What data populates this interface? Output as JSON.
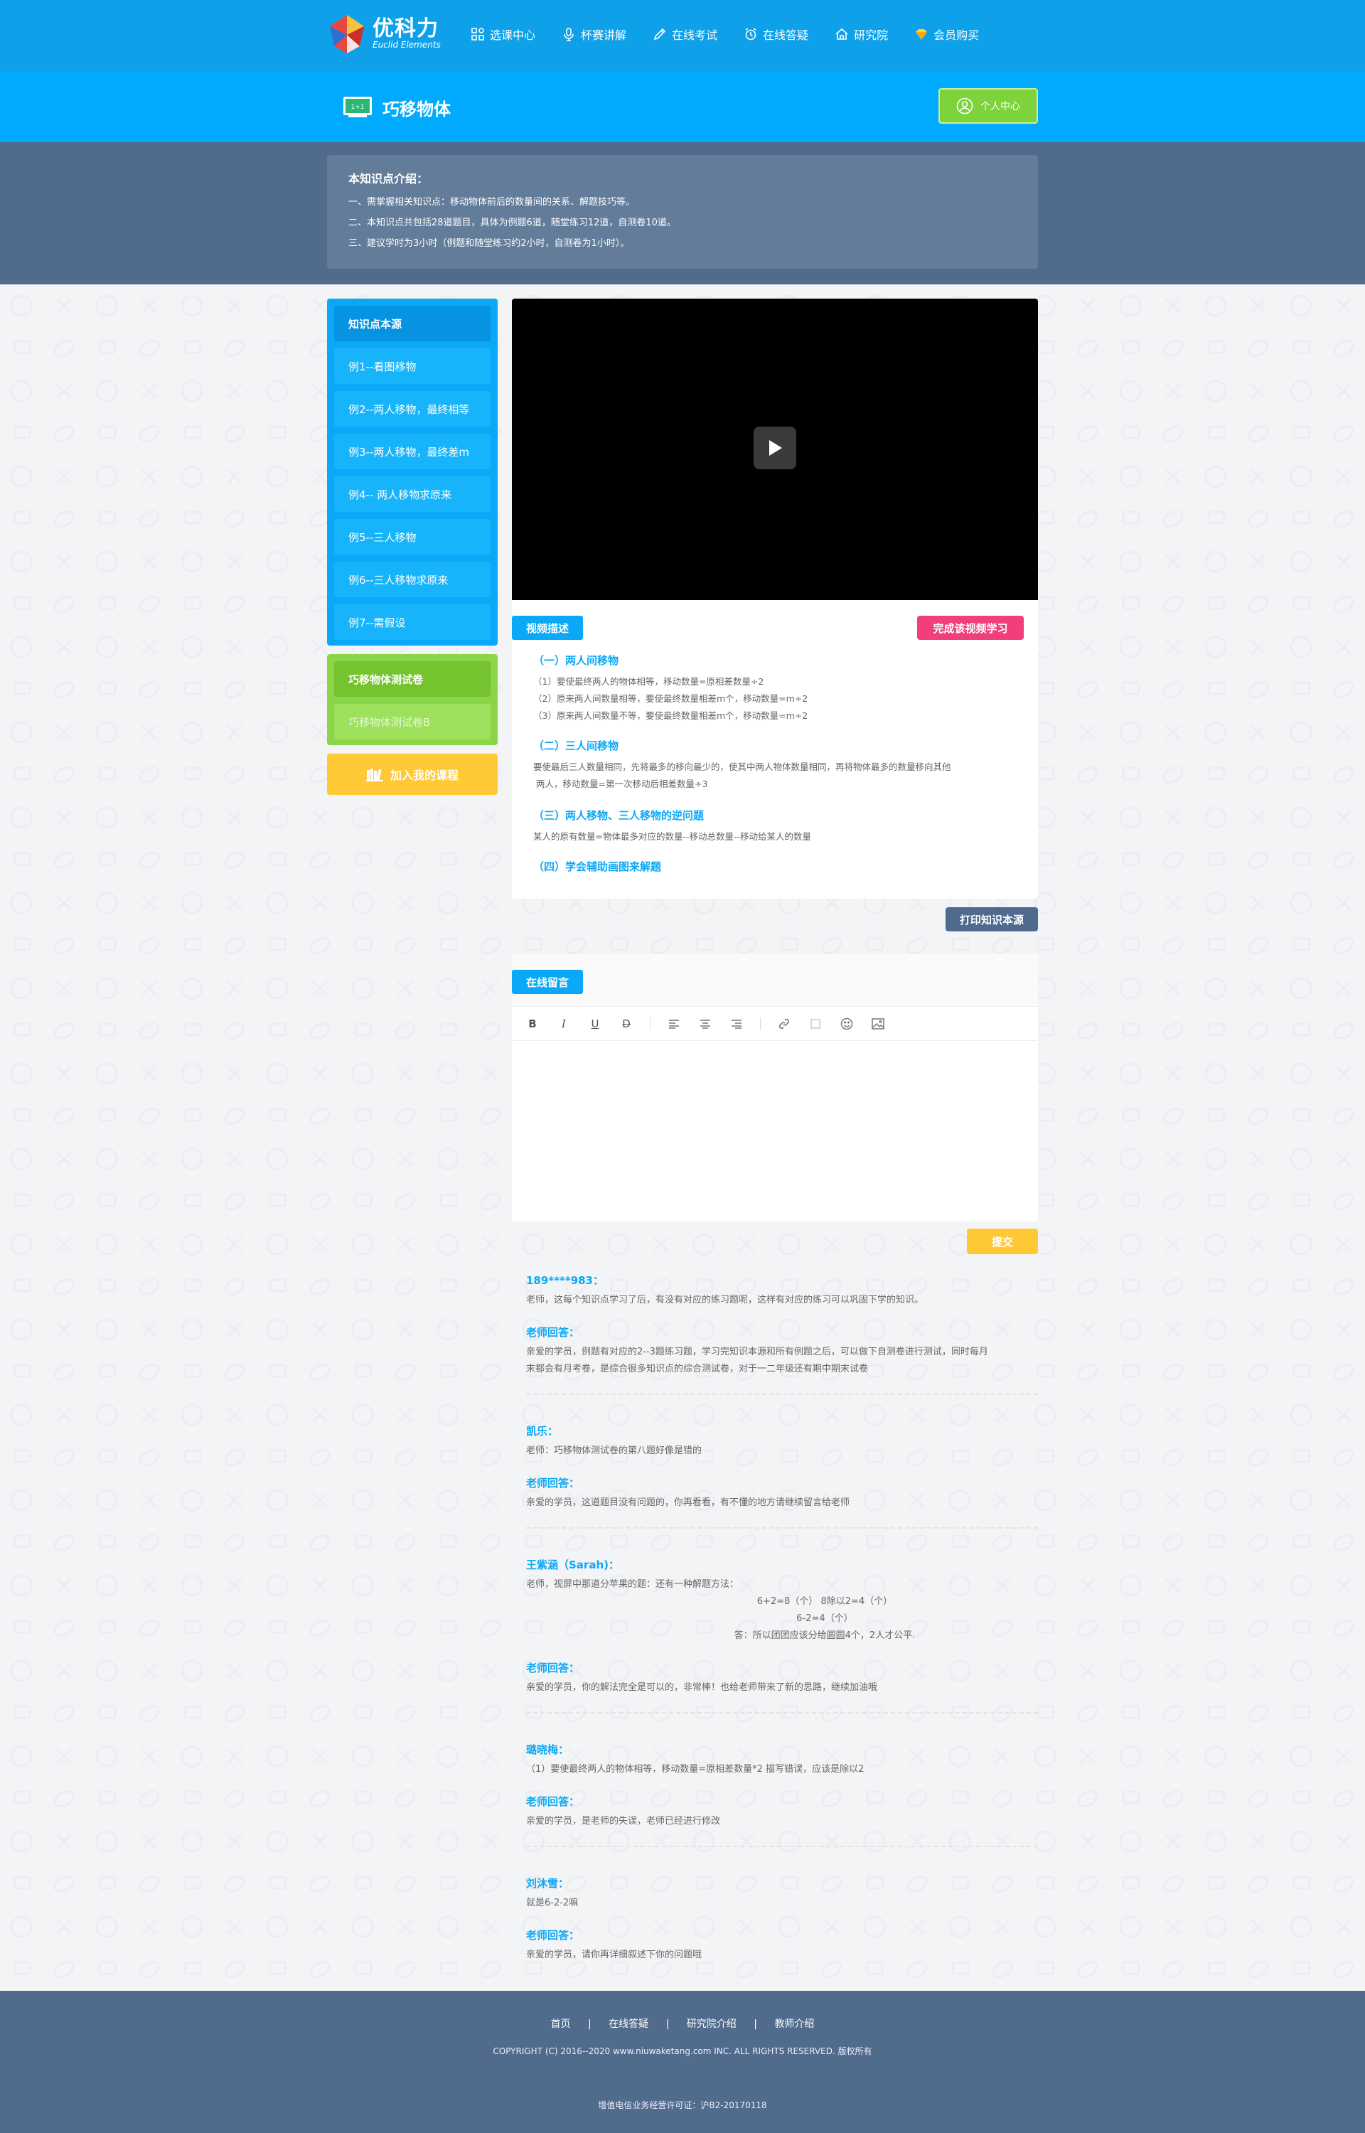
{
  "brand": {
    "name": "优科力",
    "tagline": "Euclid Elements",
    "colors": {
      "primary": "#0ea1ea",
      "accent": "#00aaff",
      "green": "#7ed33c",
      "yellow": "#ffc936",
      "pink": "#f03f7c",
      "slate": "#506b8c"
    }
  },
  "nav": [
    {
      "label": "选课中心",
      "icon": "grid-icon"
    },
    {
      "label": "杯赛讲解",
      "icon": "microphone-icon"
    },
    {
      "label": "在线考试",
      "icon": "pencil-icon"
    },
    {
      "label": "在线答疑",
      "icon": "alarm-clock-icon"
    },
    {
      "label": "研究院",
      "icon": "home-icon"
    },
    {
      "label": "会员购买",
      "icon": "diamond-icon"
    }
  ],
  "page": {
    "title": "巧移物体",
    "personal_center": "个人中心"
  },
  "intro": {
    "heading": "本知识点介绍：",
    "lines": [
      "一、需掌握相关知识点：移动物体前后的数量间的关系、解题技巧等。",
      "二、本知识点共包括28道题目，具体为例题6道，随堂练习12道，自测卷10道。",
      "三、建议学时为3小时（例题和随堂练习约2小时，自测卷为1小时）。"
    ]
  },
  "sidebar": {
    "items": [
      "知识点本源",
      "例1--看图移物",
      "例2--两人移物，最终相等",
      "例3--两人移物，最终差m",
      "例4-- 两人移物求原来",
      "例5--三人移物",
      "例6--三人移物求原来",
      "例7--需假设"
    ],
    "tests": [
      "巧移物体测试卷",
      "巧移物体测试卷B"
    ],
    "add_course": "加入我的课程"
  },
  "description": {
    "tab": "视频描述",
    "complete_button": "完成该视频学习",
    "sections": [
      {
        "title": "（一）两人间移物",
        "lines": [
          "（1）要使最终两人的物体相等，移动数量=原相差数量÷2",
          "（2）原来两人间数量相等，要使最终数量相差m个，移动数量=m÷2",
          "（3）原来两人间数量不等，要使最终数量相差m个，移动数量=m÷2"
        ]
      },
      {
        "title": "（二）三人间移物",
        "lines": [
          "要使最后三人数量相同，先将最多的移向最少的，使其中两人物体数量相同，再将物体最多的数量移向其他",
          "两人，移动数量=第一次移动后相差数量÷3"
        ]
      },
      {
        "title": "（三）两人移物、三人移物的逆问题",
        "lines": [
          "某人的原有数量=物体最多对应的数量--移动总数量--移动给某人的数量"
        ]
      },
      {
        "title": "（四）学会辅助画图来解题",
        "lines": []
      }
    ],
    "print_button": "打印知识本源"
  },
  "comment_editor": {
    "tab": "在线留言",
    "submit": "提交",
    "toolbar": [
      "bold-icon",
      "italic-icon",
      "underline-icon",
      "strikethrough-icon",
      "align-left-icon",
      "align-center-icon",
      "align-right-icon",
      "link-icon",
      "checkbox-icon",
      "emoji-icon",
      "image-icon"
    ]
  },
  "comments": [
    {
      "name": "189****983：",
      "question": [
        "老师，这每个知识点学习了后，有没有对应的练习题呢，这样有对应的练习可以巩固下学的知识。"
      ],
      "answer_label": "老师回答：",
      "answer": [
        "亲爱的学员，例题有对应的2--3题练习题，学习完知识本源和所有例题之后，可以做下自测卷进行测试，同时每月",
        "末都会有月考卷，是综合很多知识点的综合测试卷，对于一二年级还有期中期末试卷"
      ]
    },
    {
      "name": "凯乐：",
      "question": [
        "老师：巧移物体测试卷的第八题好像是错的"
      ],
      "answer_label": "老师回答：",
      "answer": [
        "亲爱的学员，这道题目没有问题的，你再看看，有不懂的地方请继续留言给老师"
      ]
    },
    {
      "name": "王紫涵（Sarah)：",
      "question": [
        "老师，视屏中那道分苹果的题：还有一种解题方法："
      ],
      "question_center": [
        "6+2=8（个）   8除以2=4（个）",
        "6-2=4（个）",
        "答：所以团团应该分给圆圆4个，2人才公平."
      ],
      "answer_label": "老师回答：",
      "answer": [
        "亲爱的学员，你的解法完全是可以的，非常棒！也给老师带来了新的思路，继续加油哦"
      ]
    },
    {
      "name": "璐晓梅：",
      "question": [
        "（1）要使最终两人的物体相等，移动数量=原相差数量*2  描写错误，应该是除以2"
      ],
      "answer_label": "老师回答：",
      "answer": [
        "亲爱的学员，是老师的失误，老师已经进行修改"
      ]
    },
    {
      "name": "刘沐雪：",
      "question": [
        "就是6-2-2嘛"
      ],
      "answer_label": "老师回答：",
      "answer": [
        "亲爱的学员，请你再详细叙述下你的问题哦"
      ]
    }
  ],
  "footer": {
    "links": [
      "首页",
      "在线答疑",
      "研究院介绍",
      "教师介绍"
    ],
    "separator": "|",
    "copyright": "COPYRIGHT (C) 2016--2020 www.niuwaketang.com INC. ALL RIGHTS RESERVED. 版权所有",
    "license": "增值电信业务经营许可证：沪B2-20170118"
  }
}
